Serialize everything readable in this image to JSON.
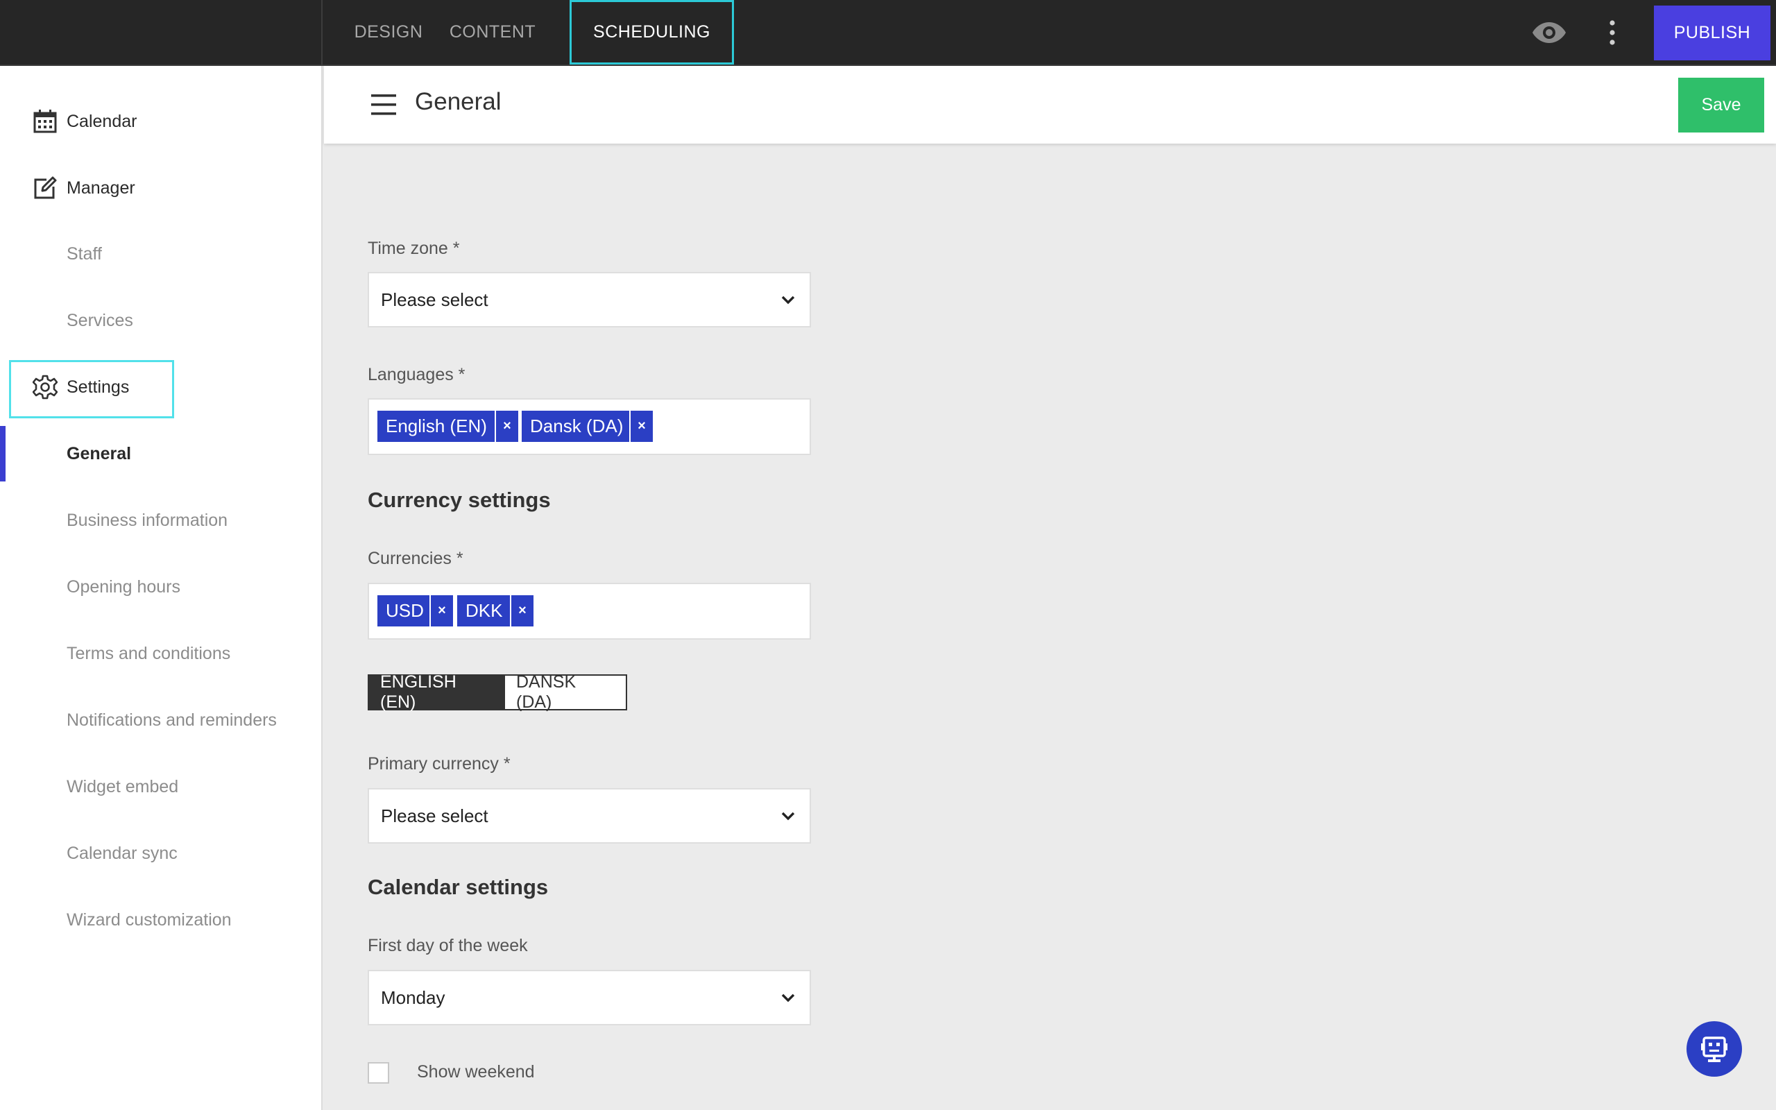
{
  "topbar": {
    "tabs": [
      {
        "label": "DESIGN"
      },
      {
        "label": "CONTENT"
      },
      {
        "label": "SCHEDULING"
      }
    ],
    "preview_icon": "eye-icon",
    "more_icon": "more-vertical-icon",
    "publish_label": "PUBLISH",
    "publish_color": "#4a3fe0",
    "active_tab_outline_color": "#2cc9d6"
  },
  "sidebar": {
    "items": [
      {
        "label": "Calendar",
        "icon": "calendar-icon"
      },
      {
        "label": "Manager",
        "icon": "edit-icon"
      },
      {
        "label": "Staff"
      },
      {
        "label": "Services"
      },
      {
        "label": "Settings",
        "icon": "gear-icon"
      },
      {
        "label": "General"
      },
      {
        "label": "Business information"
      },
      {
        "label": "Opening hours"
      },
      {
        "label": "Terms and conditions"
      },
      {
        "label": "Notifications and reminders"
      },
      {
        "label": "Widget embed"
      },
      {
        "label": "Calendar sync"
      },
      {
        "label": "Wizard customization"
      }
    ],
    "active_item": "General",
    "accent_color": "#3b3fd0"
  },
  "header": {
    "menu_icon": "hamburger-icon",
    "title": "General",
    "save_label": "Save",
    "save_color": "#2fbf6a"
  },
  "form": {
    "timezone": {
      "label": "Time zone *",
      "value": "Please select"
    },
    "languages": {
      "label": "Languages *",
      "tags": [
        {
          "label": "English (EN)",
          "remove": "×"
        },
        {
          "label": "Dansk (DA)",
          "remove": "×"
        }
      ]
    },
    "currency_section": "Currency settings",
    "currencies": {
      "label": "Currencies *",
      "tags": [
        {
          "label": "USD",
          "remove": "×"
        },
        {
          "label": "DKK",
          "remove": "×"
        }
      ]
    },
    "language_toggle": {
      "options": [
        {
          "label": "ENGLISH (EN)"
        },
        {
          "label": "DANSK (DA)"
        }
      ],
      "selected": "ENGLISH (EN)"
    },
    "primary_currency": {
      "label": "Primary currency *",
      "value": "Please select"
    },
    "calendar_section": "Calendar settings",
    "first_day": {
      "label": "First day of the week",
      "value": "Monday"
    },
    "show_weekend": {
      "label": "Show weekend",
      "checked": false
    },
    "tag_color": "#2b3fc4"
  },
  "floating": {
    "assistant_icon": "robot-icon"
  }
}
